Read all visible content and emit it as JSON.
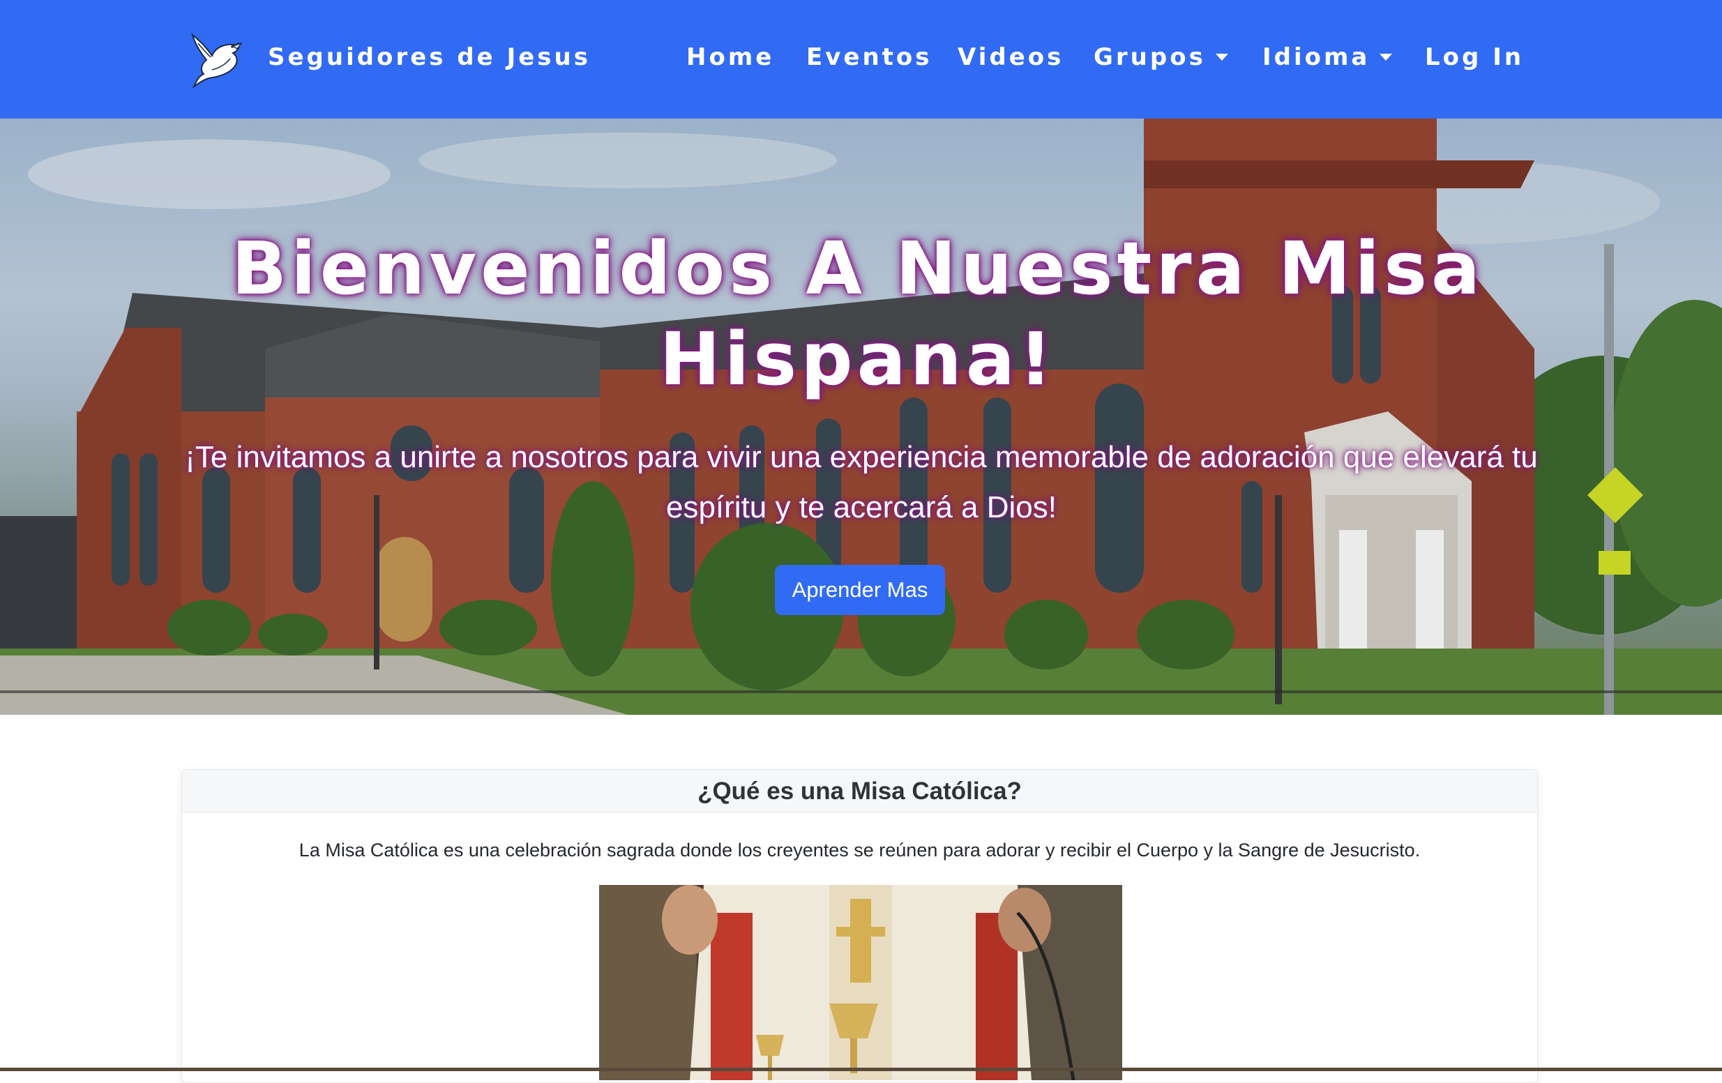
{
  "navbar": {
    "brand_name": "Seguidores de Jesus",
    "logo_icon": "dove-icon",
    "items": [
      {
        "label": "Home",
        "dropdown": false
      },
      {
        "label": "Eventos",
        "dropdown": false
      },
      {
        "label": "Videos",
        "dropdown": false
      },
      {
        "label": "Grupos",
        "dropdown": true
      },
      {
        "label": "Idioma",
        "dropdown": true
      },
      {
        "label": "Log In",
        "dropdown": false
      }
    ]
  },
  "hero": {
    "title": "Bienvenidos A Nuestra Misa Hispana!",
    "subtitle": "¡Te invitamos a unirte a nosotros para vivir una experiencia memorable de adoración que elevará tu espíritu y te acercará a Dios!",
    "button_label": "Aprender Mas",
    "background_image": "church-photo"
  },
  "card": {
    "header": "¿Qué es una Misa Católica?",
    "text": "La Misa Católica es una celebración sagrada donde los creyentes se reúnen para adorar y recibir el Cuerpo y la Sangre de Jesucristo.",
    "image": "priest-mass-photo"
  },
  "colors": {
    "primary": "#316bf3",
    "title_glow": "#8a1a8a"
  }
}
